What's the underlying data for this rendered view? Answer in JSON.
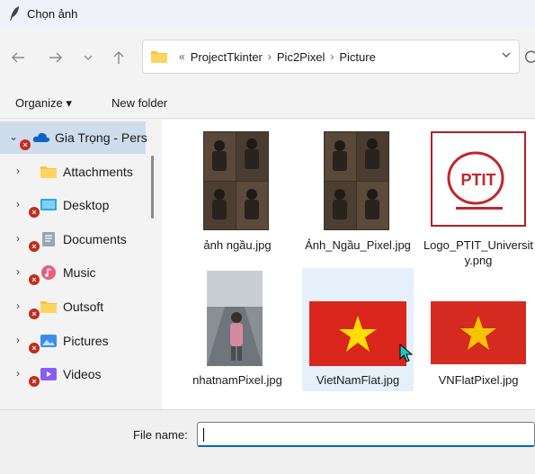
{
  "window": {
    "title": "Chọn ảnh"
  },
  "nav": {
    "back_icon": "arrow-left-icon",
    "forward_icon": "arrow-right-icon",
    "recent_icon": "chevron-down-icon",
    "up_icon": "arrow-up-icon"
  },
  "address": {
    "overflow": "«",
    "crumbs": [
      "ProjectTkinter",
      "Pic2Pixel",
      "Picture"
    ]
  },
  "toolbar": {
    "organize_label": "Organize ▾",
    "new_folder_label": "New folder"
  },
  "sidebar": {
    "items": [
      {
        "label": "Gia Trọng - Pers",
        "icon": "onedrive-cloud-icon"
      },
      {
        "label": "Attachments",
        "icon": "folder-icon"
      },
      {
        "label": "Desktop",
        "icon": "desktop-icon"
      },
      {
        "label": "Documents",
        "icon": "documents-icon"
      },
      {
        "label": "Music",
        "icon": "music-icon"
      },
      {
        "label": "Outsoft",
        "icon": "folder-icon"
      },
      {
        "label": "Pictures",
        "icon": "pictures-icon"
      },
      {
        "label": "Videos",
        "icon": "videos-icon"
      }
    ]
  },
  "files": [
    {
      "name": "ảnh ngầu.jpg"
    },
    {
      "name": "Ảnh_Ngầu_Pixel.jpg"
    },
    {
      "name": "Logo_PTIT_University.png"
    },
    {
      "name": "nhatnamPixel.jpg"
    },
    {
      "name": "VietNamFlat.jpg"
    },
    {
      "name": "VNFlatPixel.jpg"
    }
  ],
  "logo_text": "PTIT",
  "filename": {
    "label": "File name:",
    "value": ""
  },
  "colors": {
    "flag_red": "#da251d",
    "flag_star": "#ffde00",
    "accent": "#0067c0"
  }
}
